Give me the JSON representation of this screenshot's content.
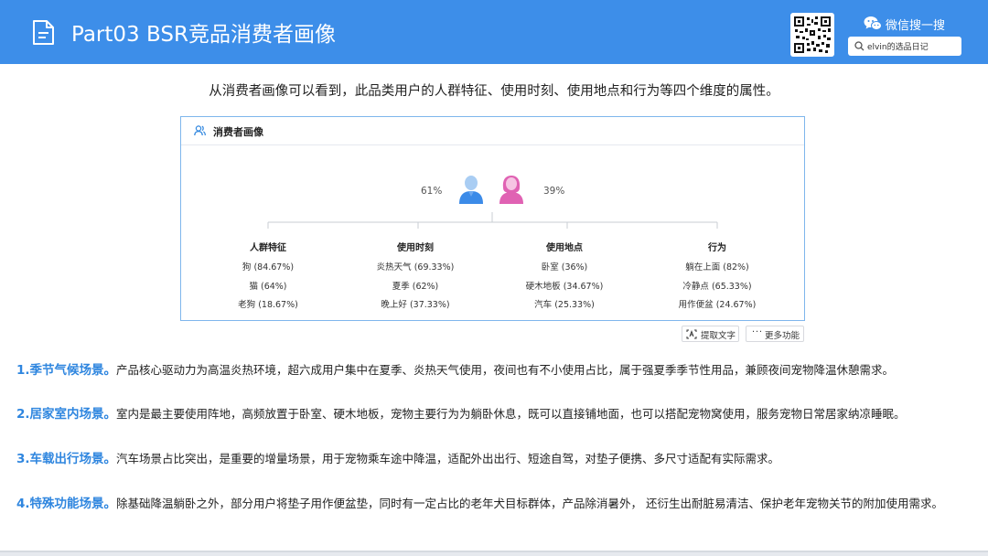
{
  "header": {
    "title": "Part03 BSR竞品消费者画像",
    "wechat_label": "微信搜一搜",
    "search_text": "elvin的选品日记"
  },
  "intro": "从消费者画像可以看到，此品类用户的人群特征、使用时刻、使用地点和行为等四个维度的属性。",
  "card": {
    "title": "消费者画像",
    "gender": {
      "male_pct": "61%",
      "female_pct": "39%"
    },
    "columns": [
      {
        "title": "人群特征",
        "items": [
          "狗 (84.67%)",
          "猫 (64%)",
          "老狗 (18.67%)"
        ]
      },
      {
        "title": "使用时刻",
        "items": [
          "炎热天气 (69.33%)",
          "夏季 (62%)",
          "晚上好 (37.33%)"
        ]
      },
      {
        "title": "使用地点",
        "items": [
          "卧室 (36%)",
          "硬木地板 (34.67%)",
          "汽车 (25.33%)"
        ]
      },
      {
        "title": "行为",
        "items": [
          "躺在上面 (82%)",
          "冷静点 (65.33%)",
          "用作便盆 (24.67%)"
        ]
      }
    ]
  },
  "tools": {
    "ocr_label": "提取文字",
    "more_dots": "···",
    "more_label": "更多功能"
  },
  "scenarios": [
    {
      "label": "1.季节气候场景。",
      "text": "产品核心驱动力为高温炎热环境，超六成用户集中在夏季、炎热天气使用，夜间也有不小使用占比，属于强夏季季节性用品，兼顾夜间宠物降温休憩需求。"
    },
    {
      "label": "2.居家室内场景。",
      "text": "室内是最主要使用阵地，高频放置于卧室、硬木地板，宠物主要行为为躺卧休息，既可以直接铺地面，也可以搭配宠物窝使用，服务宠物日常居家纳凉睡眠。"
    },
    {
      "label": "3.车载出行场景。",
      "text": "汽车场景占比突出，是重要的增量场景，用于宠物乘车途中降温，适配外出出行、短途自驾，对垫子便携、多尺寸适配有实际需求。"
    },
    {
      "label": "4.特殊功能场景。",
      "text": "除基础降温躺卧之外，部分用户将垫子用作便盆垫，同时有一定占比的老年犬目标群体，产品除消暑外， 还衍生出耐脏易清洁、保护老年宠物关节的附加使用需求。"
    }
  ],
  "colors": {
    "header_bg": "#3d8ee9",
    "accent": "#2f86df",
    "male_avatar": "#3c8be8",
    "female_avatar": "#e062b3",
    "card_border": "#7fb6ec"
  }
}
